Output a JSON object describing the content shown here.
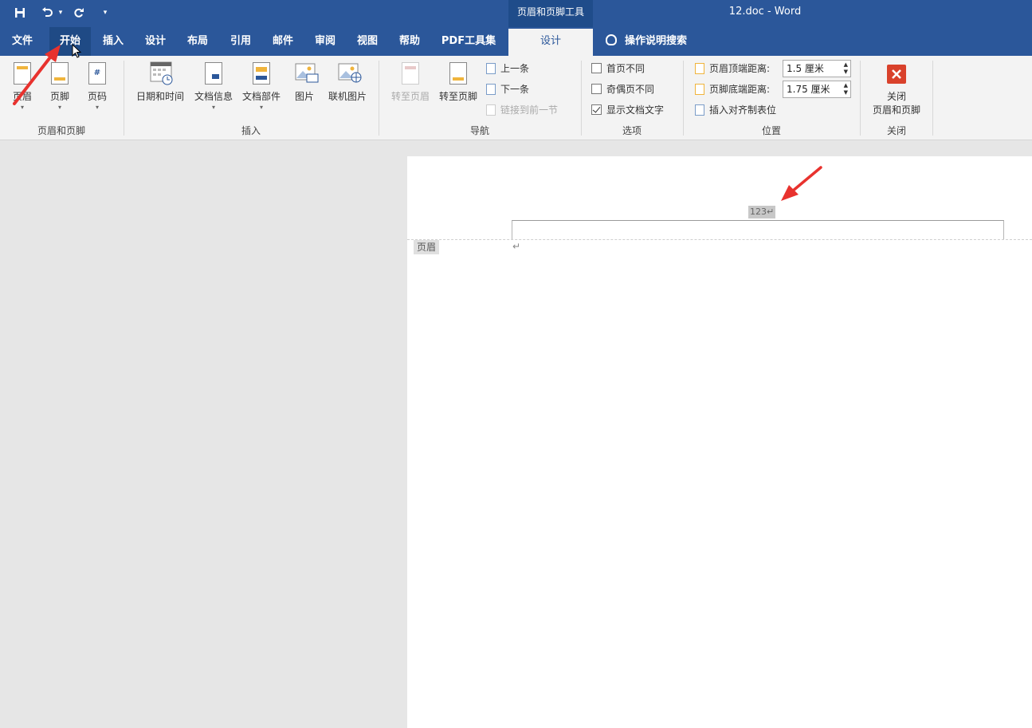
{
  "title_bar": {
    "context_tool": "页眉和页脚工具",
    "document_title": "12.doc  -  Word"
  },
  "tabs": [
    {
      "label": "文件"
    },
    {
      "label": "开始"
    },
    {
      "label": "插入"
    },
    {
      "label": "设计"
    },
    {
      "label": "布局"
    },
    {
      "label": "引用"
    },
    {
      "label": "邮件"
    },
    {
      "label": "审阅"
    },
    {
      "label": "视图"
    },
    {
      "label": "帮助"
    },
    {
      "label": "PDF工具集"
    },
    {
      "label": "设计"
    }
  ],
  "tell_me": "操作说明搜索",
  "ribbon": {
    "hf_group": {
      "label": "页眉和页脚",
      "header": "页眉",
      "footer": "页脚",
      "page_number": "页码"
    },
    "insert_group": {
      "label": "插入",
      "datetime": "日期和时间",
      "docinfo": "文档信息",
      "quickparts": "文档部件",
      "pictures": "图片",
      "online_pictures": "联机图片"
    },
    "nav_group": {
      "label": "导航",
      "goto_header": "转至页眉",
      "goto_footer": "转至页脚",
      "previous": "上一条",
      "next": "下一条",
      "link_previous": "链接到前一节"
    },
    "options_group": {
      "label": "选项",
      "different_first": "首页不同",
      "different_odd_even": "奇偶页不同",
      "show_doc_text": "显示文档文字"
    },
    "position_group": {
      "label": "位置",
      "header_top_label": "页眉顶端距离:",
      "header_top_value": "1.5 厘米",
      "footer_bottom_label": "页脚底端距离:",
      "footer_bottom_value": "1.75 厘米",
      "insert_align_tab": "插入对齐制表位"
    },
    "close_group": {
      "label": "关闭",
      "close_line1": "关闭",
      "close_line2": "页眉和页脚"
    }
  },
  "document": {
    "header_text": "123↵",
    "header_tag": "页眉",
    "paragraph_mark": "↵"
  },
  "colors": {
    "ribbon_blue": "#2b579a",
    "annotation_red": "#e8322e",
    "close_button_red": "#d9412b"
  }
}
